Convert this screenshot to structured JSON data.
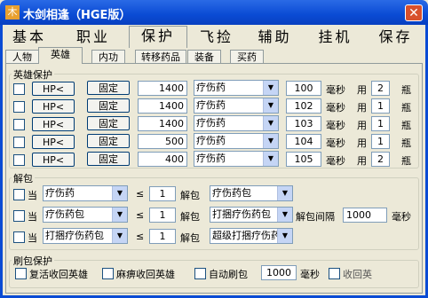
{
  "window": {
    "title": "木剑相逢（HGE版）",
    "close": "✕"
  },
  "tabs": [
    "基本",
    "职业",
    "保护",
    "飞捡",
    "辅助",
    "挂机",
    "保存"
  ],
  "subtabs": [
    "人物",
    "英雄",
    "内功",
    "转移药品",
    "装备",
    "买药"
  ],
  "hero": {
    "label": "英雄保护",
    "hp_btn": "HP<",
    "fixed_btn": "固定",
    "ms": "毫秒",
    "use": "用",
    "bottle": "瓶",
    "rows": [
      {
        "hp": "1400",
        "potion": "疗伤药",
        "interval": "100",
        "count": "2"
      },
      {
        "hp": "1400",
        "potion": "疗伤药",
        "interval": "102",
        "count": "1"
      },
      {
        "hp": "1400",
        "potion": "疗伤药",
        "interval": "103",
        "count": "1"
      },
      {
        "hp": "500",
        "potion": "疗伤药",
        "interval": "104",
        "count": "1"
      },
      {
        "hp": "400",
        "potion": "疗伤药",
        "interval": "105",
        "count": "2"
      }
    ]
  },
  "unpack": {
    "label": "解包",
    "when": "当",
    "leq": "≤",
    "unpack": "解包",
    "interval_label": "解包间隔",
    "interval": "1000",
    "ms": "毫秒",
    "rows": [
      {
        "item": "疗伤药",
        "qty": "1",
        "pack": "疗伤药包"
      },
      {
        "item": "疗伤药包",
        "qty": "1",
        "pack": "打捆疗伤药包"
      },
      {
        "item": "打捆疗伤药包",
        "qty": "1",
        "pack": "超级打捆疗伤药"
      }
    ]
  },
  "refresh": {
    "label": "刷包保护",
    "revive": "复活收回英雄",
    "paralyze": "麻痹收回英雄",
    "auto": "自动刷包",
    "interval": "1000",
    "ms": "毫秒",
    "recv": "收回英"
  }
}
